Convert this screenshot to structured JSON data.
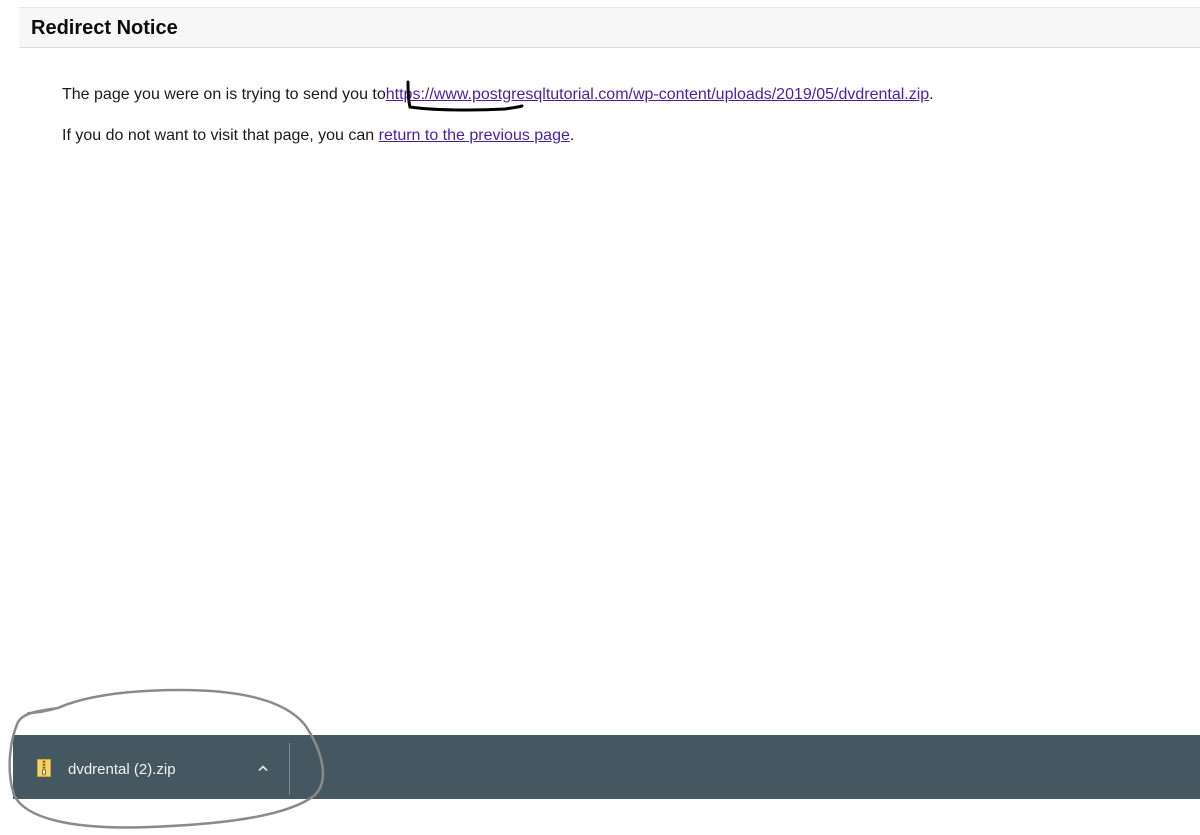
{
  "notice": {
    "title": "Redirect Notice"
  },
  "message": {
    "line1_prefix": "The page you were on is trying to send you to",
    "redirect_url": "https://www.postgresqltutorial.com/wp-content/uploads/2019/05/dvdrental.zip",
    "line1_suffix": ".",
    "line2_prefix": "If you do not want to visit that page, you can ",
    "return_link": "return to the previous page",
    "line2_suffix": "."
  },
  "download_shelf": {
    "items": [
      {
        "filename": "dvdrental (2).zip",
        "icon": "zip-file-icon",
        "menu_icon": "chevron-up-icon"
      }
    ],
    "background_color": "#455861"
  },
  "colors": {
    "link": "#4b1fa3",
    "annotation_underline": "#000000",
    "annotation_circle": "#8a8a8a"
  }
}
